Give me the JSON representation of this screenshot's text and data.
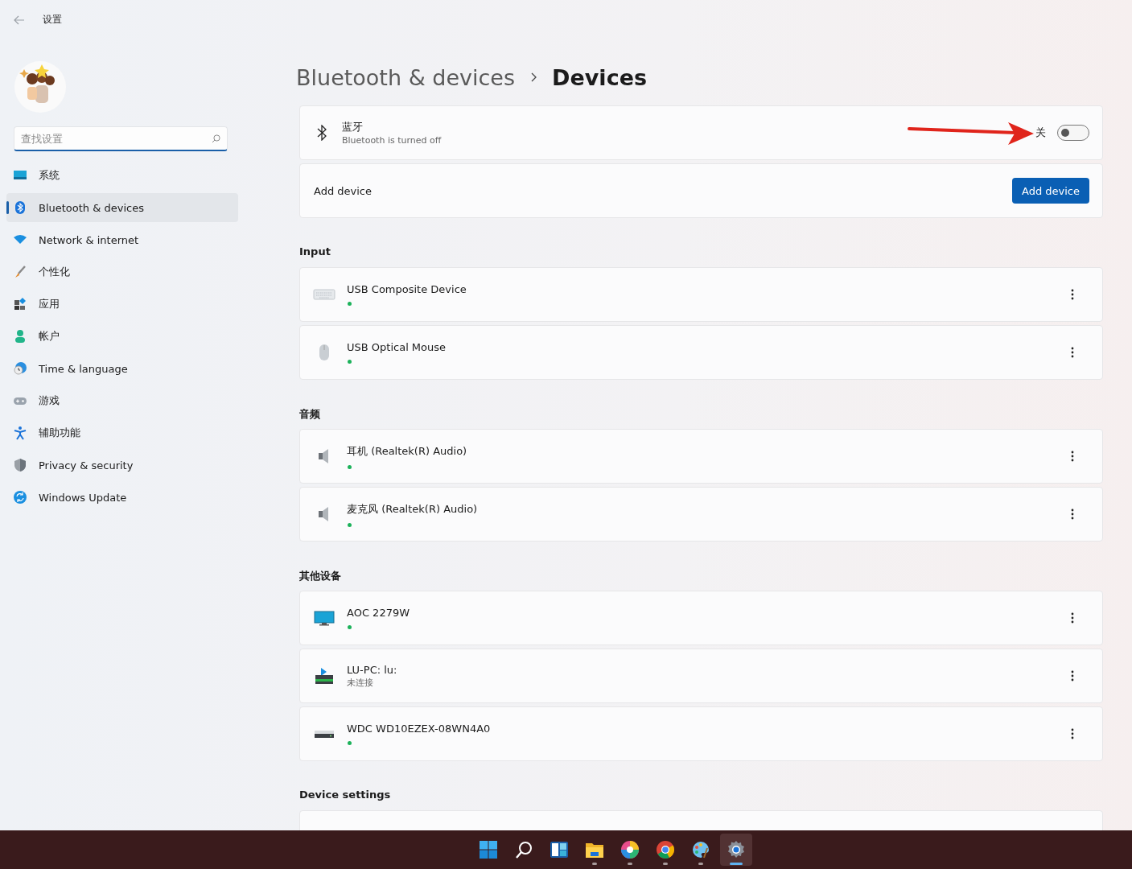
{
  "window": {
    "title": "设置"
  },
  "search": {
    "placeholder": "查找设置"
  },
  "sidebar": {
    "items": [
      {
        "label": "系统",
        "kind": "system",
        "selected": false
      },
      {
        "label": "Bluetooth & devices",
        "kind": "bluetooth",
        "selected": true
      },
      {
        "label": "Network & internet",
        "kind": "network",
        "selected": false
      },
      {
        "label": "个性化",
        "kind": "brush",
        "selected": false
      },
      {
        "label": "应用",
        "kind": "apps",
        "selected": false
      },
      {
        "label": "帐户",
        "kind": "account",
        "selected": false
      },
      {
        "label": "Time & language",
        "kind": "time",
        "selected": false
      },
      {
        "label": "游戏",
        "kind": "game",
        "selected": false
      },
      {
        "label": "辅助功能",
        "kind": "access",
        "selected": false
      },
      {
        "label": "Privacy & security",
        "kind": "shield",
        "selected": false
      },
      {
        "label": "Windows Update",
        "kind": "update",
        "selected": false
      }
    ]
  },
  "breadcrumb": [
    "Bluetooth & devices",
    "Devices"
  ],
  "bluetooth": {
    "title": "蓝牙",
    "subtitle": "Bluetooth is turned off",
    "state_label": "关",
    "on": false
  },
  "add_device": {
    "label": "Add device",
    "button": "Add device"
  },
  "sections": [
    {
      "heading": "Input",
      "devices": [
        {
          "name": "USB Composite Device",
          "kind": "keyboard",
          "connected": true
        },
        {
          "name": "USB Optical Mouse",
          "kind": "mouse",
          "connected": true
        }
      ]
    },
    {
      "heading": "音频",
      "devices": [
        {
          "name": "耳机 (Realtek(R) Audio)",
          "kind": "speaker",
          "connected": true
        },
        {
          "name": "麦克风 (Realtek(R) Audio)",
          "kind": "speaker",
          "connected": true
        }
      ]
    },
    {
      "heading": "其他设备",
      "devices": [
        {
          "name": "AOC 2279W",
          "kind": "monitor",
          "connected": true
        },
        {
          "name": "LU-PC: lu:",
          "kind": "media",
          "connected": false,
          "status": "未连接"
        },
        {
          "name": "WDC WD10EZEX-08WN4A0",
          "kind": "drive",
          "connected": true
        }
      ]
    }
  ],
  "device_settings": {
    "heading": "Device settings"
  },
  "taskbar": {
    "apps": [
      {
        "kind": "start",
        "running": false,
        "selected": false
      },
      {
        "kind": "search",
        "running": false,
        "selected": false
      },
      {
        "kind": "widgets",
        "running": false,
        "selected": false
      },
      {
        "kind": "folder",
        "running": true,
        "selected": false
      },
      {
        "kind": "pinwheel",
        "running": true,
        "selected": false
      },
      {
        "kind": "browser",
        "running": true,
        "selected": false
      },
      {
        "kind": "palette",
        "running": true,
        "selected": false
      },
      {
        "kind": "settings",
        "running": true,
        "selected": true
      }
    ]
  }
}
